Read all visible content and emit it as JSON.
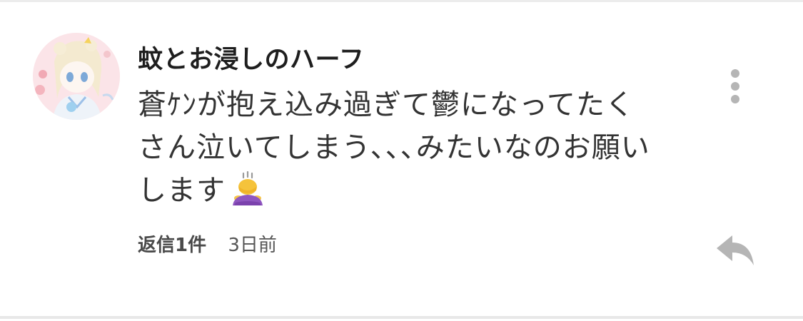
{
  "comment": {
    "username": "蚊とお浸しのハーフ",
    "body_lines": [
      "蒼ｹﾝが抱え込み過ぎて鬱になってたく",
      "さん泣いてしまう､､､みたいなのお願い",
      "します"
    ],
    "emoji_icon": "person-bowing-icon",
    "reply_count_label": "返信1件",
    "timestamp": "3日前"
  },
  "icons": {
    "more": "more-vertical-icon",
    "reply": "reply-arrow-icon"
  },
  "colors": {
    "text_primary": "#1e1e1e",
    "text_body": "#333333",
    "icon_gray": "#b5b5b5",
    "divider": "#e8e8e8"
  }
}
